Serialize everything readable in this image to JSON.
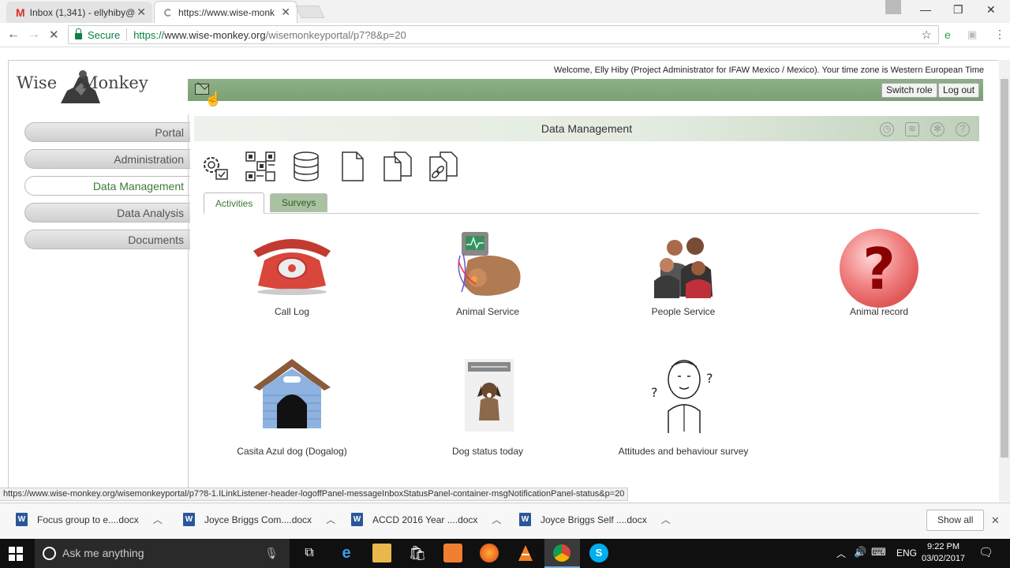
{
  "browser": {
    "tabs": [
      {
        "label": "Inbox (1,341) - ellyhiby@",
        "icon": "gmail-icon"
      },
      {
        "label": "https://www.wise-monk",
        "icon": "loading-icon"
      }
    ],
    "secure_label": "Secure",
    "url": {
      "scheme": "https://",
      "host": "www.wise-monkey.org",
      "path": "/wisemonkeyportal/p7?8&p=20"
    }
  },
  "page": {
    "logo": {
      "word1": "Wise",
      "word2": "Monkey"
    },
    "welcome": "Welcome, Elly Hiby (Project Administrator for IFAW Mexico / Mexico). Your time zone is Western European Time",
    "header_buttons": {
      "switch_role": "Switch role",
      "log_out": "Log out"
    },
    "sidebar": [
      {
        "label": "Portal",
        "selected": false
      },
      {
        "label": "Administration",
        "selected": false
      },
      {
        "label": "Data Management",
        "selected": true
      },
      {
        "label": "Data Analysis",
        "selected": false
      },
      {
        "label": "Documents",
        "selected": false
      }
    ],
    "section_title": "Data Management",
    "section_icons": [
      "alarm-clock-icon",
      "rss-icon",
      "gear-icon",
      "help-icon"
    ],
    "tool_icons": [
      "settings-check-icon",
      "qr-code-icon",
      "database-icon",
      "document-icon",
      "documents-icon",
      "document-link-icon"
    ],
    "tabs": [
      {
        "label": "Activities",
        "active": true
      },
      {
        "label": "Surveys",
        "active": false
      }
    ],
    "activities": [
      {
        "label": "Call Log",
        "icon": "telephone-icon"
      },
      {
        "label": "Animal Service",
        "icon": "animal-service-icon"
      },
      {
        "label": "People Service",
        "icon": "people-icon"
      },
      {
        "label": "Animal record",
        "icon": "question-mark-icon"
      },
      {
        "label": "Casita Azul dog (Dogalog)",
        "icon": "dog-house-icon"
      },
      {
        "label": "Dog status today",
        "icon": "dog-status-icon"
      },
      {
        "label": "Attitudes and behaviour survey",
        "icon": "thinking-person-icon"
      }
    ],
    "status_url": "https://www.wise-monkey.org/wisemonkeyportal/p7?8-1.ILinkListener-header-logoffPanel-messageInboxStatusPanel-container-msgNotificationPanel-status&p=20"
  },
  "downloads": {
    "items": [
      "Focus group to e....docx",
      "Joyce Briggs Com....docx",
      "ACCD 2016 Year ....docx",
      "Joyce Briggs Self ....docx"
    ],
    "show_all": "Show all"
  },
  "taskbar": {
    "search_placeholder": "Ask me anything",
    "language": "ENG",
    "time": "9:22 PM",
    "date": "03/02/2017"
  },
  "colors": {
    "header_green": "#7fa378",
    "selected_text": "#3d7a35",
    "secure_green": "#0b8043",
    "taskbar": "#101010"
  }
}
